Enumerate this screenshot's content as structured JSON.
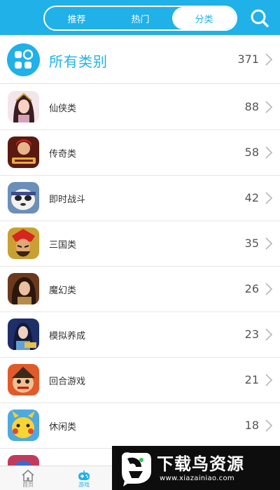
{
  "header": {
    "tabs": [
      {
        "label": "推荐",
        "active": false
      },
      {
        "label": "热门",
        "active": false
      },
      {
        "label": "分类",
        "active": true
      }
    ],
    "search_icon": "search-icon",
    "accent_color": "#1fb1e8"
  },
  "all_categories": {
    "title": "所有类别",
    "count": "371",
    "icon": "grid-icon"
  },
  "categories": [
    {
      "label": "仙侠类",
      "count": "88",
      "icon": "xianxia-game-icon"
    },
    {
      "label": "传奇类",
      "count": "58",
      "icon": "chuanqi-game-icon"
    },
    {
      "label": "即时战斗",
      "count": "42",
      "icon": "realtime-battle-game-icon"
    },
    {
      "label": "三国类",
      "count": "35",
      "icon": "three-kingdoms-game-icon"
    },
    {
      "label": "魔幻类",
      "count": "26",
      "icon": "fantasy-game-icon"
    },
    {
      "label": "模拟养成",
      "count": "23",
      "icon": "simulation-game-icon"
    },
    {
      "label": "回合游戏",
      "count": "21",
      "icon": "turn-based-game-icon"
    },
    {
      "label": "休闲类",
      "count": "18",
      "icon": "casual-game-icon"
    }
  ],
  "bottom_nav": [
    {
      "label": "首页",
      "icon": "home-icon",
      "active": false
    },
    {
      "label": "游戏",
      "icon": "gamepad-icon",
      "active": true
    }
  ],
  "watermark": {
    "title": "下载鸟资源",
    "url": "www.xiazainiao.com"
  }
}
